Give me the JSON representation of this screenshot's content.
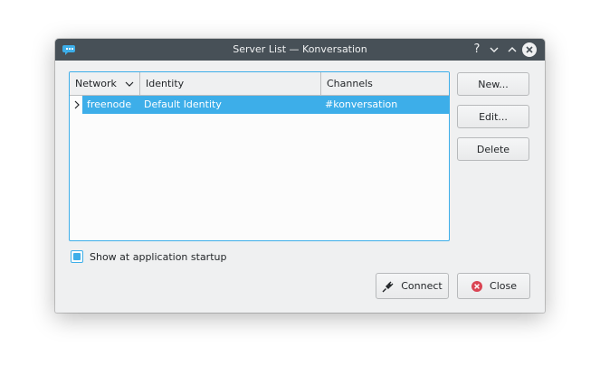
{
  "window": {
    "title": "Server List — Konversation",
    "help_glyph": "?"
  },
  "tree": {
    "columns": [
      "Network",
      "Identity",
      "Channels"
    ],
    "rows": [
      {
        "network": "freenode",
        "identity": "Default Identity",
        "channels": "#konversation",
        "selected": true
      }
    ]
  },
  "buttons": {
    "new": "New...",
    "edit": "Edit...",
    "delete": "Delete",
    "connect": "Connect",
    "close": "Close"
  },
  "options": {
    "show_at_startup_label": "Show at application startup",
    "show_at_startup_checked": true
  },
  "colors": {
    "accent": "#3daee9",
    "titlebar": "#475057",
    "close_icon": "#da4453"
  },
  "icons": {
    "app": "konversation-chat-icon",
    "connect": "plug-icon",
    "close": "close-circle-icon",
    "sort": "chevron-down-icon",
    "expander": "chevron-right-icon"
  }
}
